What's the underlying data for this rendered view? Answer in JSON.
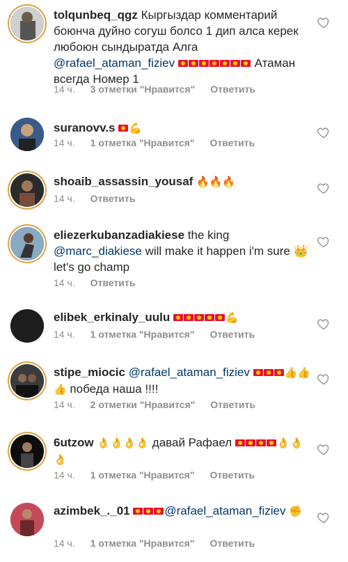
{
  "comments": [
    {
      "username": "tolqunbeq_qgz",
      "text_before": "Кыргыздар комментарий боюнча дуйно согуш болсо 1 дип алса керек любоюн сындыратда  Алга ",
      "mention": "@rafael_ataman_fiziev",
      "flag_count": 7,
      "text_after": " Атаман всегда Номер 1",
      "time": "14 ч.",
      "likes": "3 отметки \"Нравится\"",
      "reply": "Ответить"
    },
    {
      "username": "suranovv.s",
      "text_before": "",
      "flag_count": 1,
      "emoji_after": "💪",
      "time": "14 ч.",
      "likes": "1 отметка \"Нравится\"",
      "reply": "Ответить"
    },
    {
      "username": "shoaib_assassin_yousaf",
      "emoji": "🔥🔥🔥",
      "time": "14 ч.",
      "reply": "Ответить"
    },
    {
      "username": "eliezerkubanzadiakiese",
      "text_before": " the king  ",
      "mention": "@marc_diakiese",
      "text_after": " will make it happen i'm sure 👑 let's go champ",
      "time": "14 ч.",
      "reply": "Ответить"
    },
    {
      "username": "elibek_erkinaly_uulu",
      "flag_count": 5,
      "emoji_after": "💪",
      "time": "14 ч.",
      "likes": "1 отметка \"Нравится\"",
      "reply": "Ответить"
    },
    {
      "username": "stipe_miocic",
      "mention": "@rafael_ataman_fiziev",
      "flag_count": 3,
      "emoji_after": "👍👍👍",
      "text_after": " победа наша !!!!",
      "time": "14 ч.",
      "likes": "2 отметки \"Нравится\"",
      "reply": "Ответить"
    },
    {
      "username": "6utzow",
      "emoji": "👌👌👌👌",
      "text_after": " давай Рафаел ",
      "flag_count": 4,
      "emoji_after": "👌👌👌",
      "time": "14 ч.",
      "likes": "1 отметка \"Нравится\"",
      "reply": "Ответить"
    },
    {
      "username": "azimbek_._01",
      "flag_count": 3,
      "mention": "@rafael_ataman_fiziev",
      "emoji_after": "✊",
      "time": "14 ч.",
      "likes": "1 отметка \"Нравится\"",
      "reply": "Ответить"
    }
  ],
  "icons": {
    "like": "heart-outline-icon",
    "flag": "kyrgyzstan-flag-emoji"
  },
  "colors": {
    "text": "#262626",
    "meta": "#8e8e8e",
    "mention": "#00376b",
    "flag_red": "#e8112d",
    "flag_sun": "#ffcc00"
  }
}
